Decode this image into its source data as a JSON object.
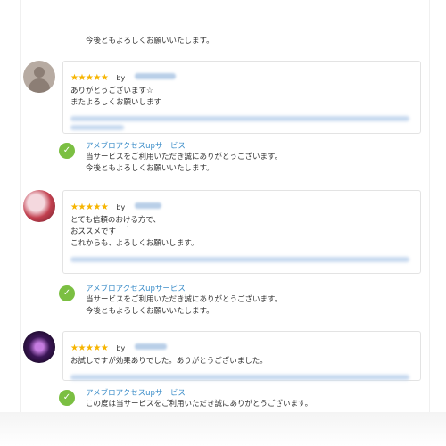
{
  "top_reply": "今後ともよろしくお願いいたします。",
  "reviews": [
    {
      "stars": "★★★★★",
      "by": "by",
      "text": "ありがとうございます☆\nまたよろしくお願いします",
      "reply": {
        "title": "アメブロアクセスupサービス",
        "text": "当サービスをご利用いただき誠にありがとうございます。\n今後ともよろしくお願いいたします。"
      }
    },
    {
      "stars": "★★★★★",
      "by": "by",
      "text": "とても信頼のおける方で、\nおススメです＾＾\nこれからも、よろしくお願いします。",
      "reply": {
        "title": "アメブロアクセスupサービス",
        "text": "当サービスをご利用いただき誠にありがとうございます。\n今後ともよろしくお願いいたします。"
      }
    },
    {
      "stars": "★★★★★",
      "by": "by",
      "text": "お試しですが効果ありでした。ありがとうございました。",
      "reply": {
        "title": "アメブロアクセスupサービス",
        "text": "この度は当サービスをご利用いただき誠にありがとうございます。"
      }
    }
  ],
  "icons": {
    "reply_icon": "leaf-icon",
    "star_color": "#f6b400",
    "accent": "#3d8ec9",
    "reply_icon_bg": "#7bbf42"
  }
}
